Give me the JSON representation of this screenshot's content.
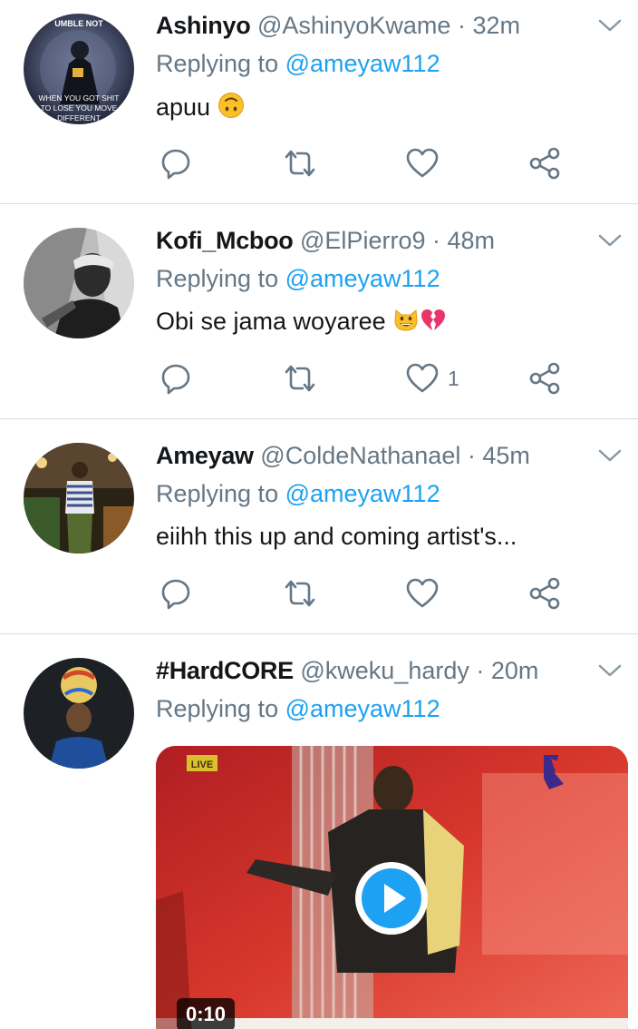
{
  "tweets": [
    {
      "name": "Ashinyo",
      "handle": "@AshinyoKwame",
      "dot": " · ",
      "time": "32m",
      "reply_prefix": "Replying to ",
      "reply_to": "@ameyaw112",
      "text": "apuu",
      "emoji": [
        "upside-down-face"
      ],
      "avatar_text_top": "UMBLE NOT",
      "avatar_text_bottom": "WHEN YOU GOT SHIT TO LOSE YOU MOVE DIFFERENT",
      "like_count": ""
    },
    {
      "name": "Kofi_Mcboo",
      "handle": "@ElPierro9",
      "dot": " · ",
      "time": "48m",
      "reply_prefix": "Replying to ",
      "reply_to": "@ameyaw112",
      "text": "Obi se jama woyaree",
      "emoji": [
        "grinning-cat",
        "broken-heart"
      ],
      "like_count": "1"
    },
    {
      "name": "Ameyaw",
      "handle": "@ColdeNathanael",
      "dot": " · ",
      "time": "45m",
      "reply_prefix": "Replying to ",
      "reply_to": "@ameyaw112",
      "text": "eiihh this up and coming artist's...",
      "emoji": [],
      "like_count": ""
    },
    {
      "name": "#HardCORE",
      "handle": "@kweku_hardy",
      "dot": " · ",
      "time": "20m",
      "reply_prefix": "Replying to ",
      "reply_to": "@ameyaw112",
      "media": {
        "type": "video",
        "duration": "0:10",
        "live_badge": "LIVE"
      }
    }
  ],
  "icons": [
    "reply-icon",
    "retweet-icon",
    "like-icon",
    "share-icon",
    "caret-down-icon",
    "play-icon"
  ],
  "colors": {
    "accent": "#1da1f2",
    "secondary_text": "#657786",
    "divider": "#d9dde1",
    "primary_text": "#14171a"
  }
}
